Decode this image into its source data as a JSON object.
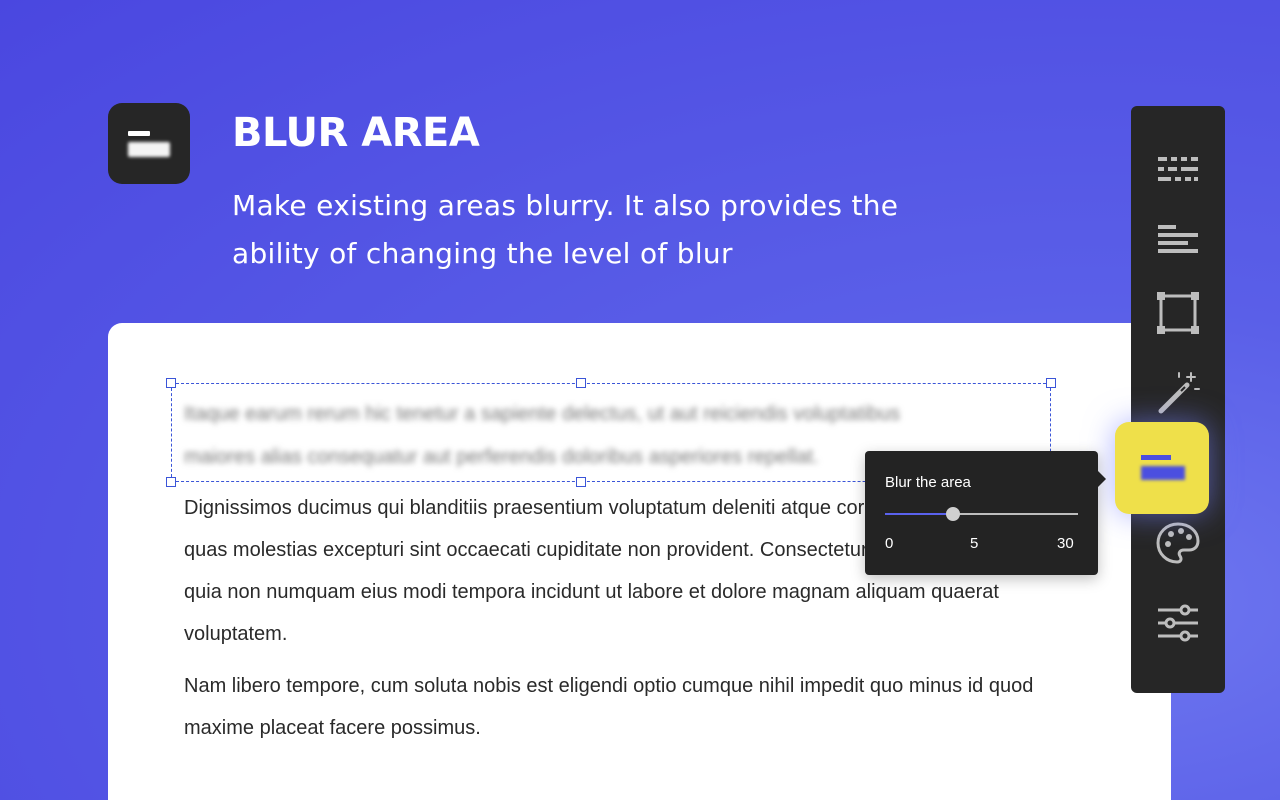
{
  "hero": {
    "title": "BLUR AREA",
    "subtitle": "Make existing areas blurry. It also provides the ability of changing the level of blur"
  },
  "document": {
    "blurred_text": "Itaque earum rerum hic tenetur a sapiente delectus, ut aut reiciendis voluptatibus\nmaiores alias consequatur aut perferendis doloribus asperiores repellat.",
    "paragraphs": [
      "Dignissimos ducimus qui blanditiis praesentium voluptatum deleniti atque corrupti quos dolores et quas molestias excepturi sint occaecati cupiditate non provident. Consectetur, adipisci velit, sed quia non numquam eius modi tempora incidunt ut labore et dolore magnam aliquam quaerat voluptatem.",
      "Nam libero tempore, cum soluta nobis est eligendi optio cumque nihil impedit quo minus id quod maxime placeat facere possimus."
    ]
  },
  "popover": {
    "title": "Blur the area",
    "slider": {
      "min": 0,
      "max": 30,
      "value": 5,
      "fill_fraction": 0.35
    },
    "tick_labels": [
      "0",
      "5",
      "30"
    ]
  },
  "toolbar": {
    "tools": [
      {
        "icon": "dashed-lines-icon"
      },
      {
        "icon": "text-align-left-icon"
      },
      {
        "icon": "crop-frame-icon"
      },
      {
        "icon": "magic-wand-icon"
      },
      {
        "icon": "blur-area-icon",
        "active": true
      },
      {
        "icon": "palette-icon"
      },
      {
        "icon": "sliders-icon"
      }
    ]
  },
  "colors": {
    "background": "#5a5fe8",
    "accent": "#4b4fe0",
    "active_tool": "#efe04a",
    "toolbar": "#262626",
    "selection": "#3b55d8"
  }
}
